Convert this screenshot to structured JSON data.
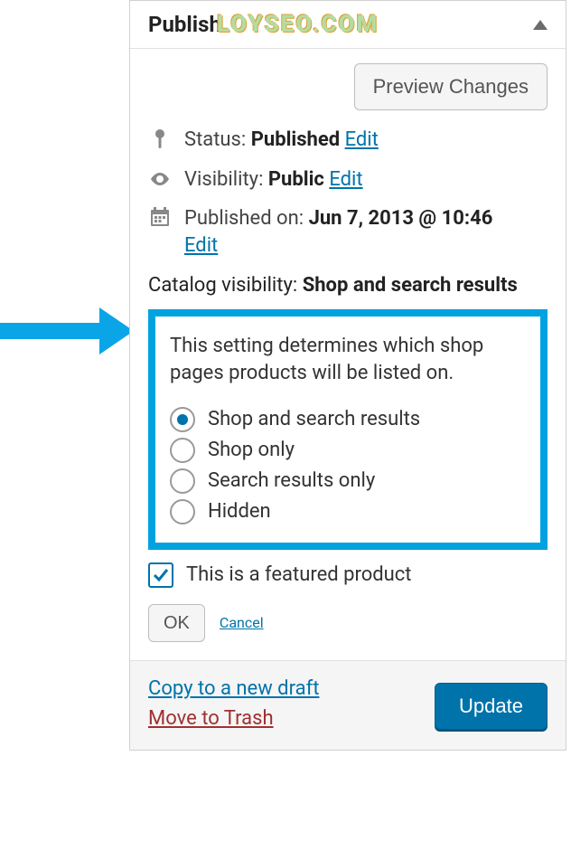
{
  "watermark": "LOYSEO.COM",
  "panel": {
    "title": "Publish",
    "preview_label": "Preview Changes",
    "status": {
      "label": "Status:",
      "value": "Published",
      "edit": "Edit"
    },
    "visibility": {
      "label": "Visibility:",
      "value": "Public",
      "edit": "Edit"
    },
    "published": {
      "label": "Published on:",
      "value": "Jun 7, 2013 @ 10:46",
      "edit": "Edit"
    },
    "catalog": {
      "label": "Catalog visibility:",
      "value": "Shop and search results",
      "help": "This setting determines which shop pages products will be listed on.",
      "options": [
        {
          "label": "Shop and search results",
          "checked": true
        },
        {
          "label": "Shop only",
          "checked": false
        },
        {
          "label": "Search results only",
          "checked": false
        },
        {
          "label": "Hidden",
          "checked": false
        }
      ],
      "featured": {
        "label": "This is a featured product",
        "checked": true
      },
      "ok": "OK",
      "cancel": "Cancel"
    },
    "footer": {
      "copy": "Copy to a new draft",
      "trash": "Move to Trash",
      "update": "Update"
    }
  }
}
